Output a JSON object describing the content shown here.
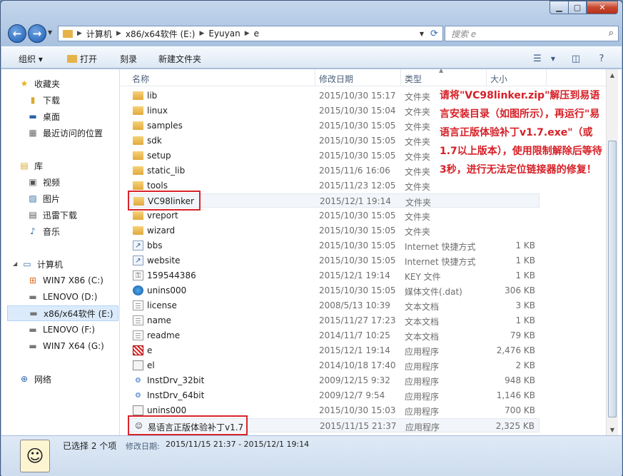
{
  "window": {
    "min_icon": "minimize-icon",
    "max_icon": "maximize-icon",
    "close_label": "✕"
  },
  "address": {
    "crumbs": [
      "计算机",
      "x86/x64软件 (E:)",
      "Eyuyan",
      "e"
    ],
    "search_placeholder": "搜索 e"
  },
  "toolbar": {
    "organize": "组织 ▾",
    "open": "打开",
    "burn": "刻录",
    "new_folder": "新建文件夹"
  },
  "nav": {
    "favorites": "收藏夹",
    "downloads": "下载",
    "desktop": "桌面",
    "recent": "最近访问的位置",
    "libraries": "库",
    "videos": "视频",
    "pictures": "图片",
    "thunder": "迅雷下载",
    "music": "音乐",
    "computer": "计算机",
    "drive_c": "WIN7 X86 (C:)",
    "drive_d": "LENOVO (D:)",
    "drive_e": "x86/x64软件 (E:)",
    "drive_f": "LENOVO (F:)",
    "drive_g": "WIN7 X64 (G:)",
    "network": "网络"
  },
  "columns": {
    "name": "名称",
    "date": "修改日期",
    "type": "类型",
    "size": "大小"
  },
  "files": [
    {
      "name": "lib",
      "date": "2015/10/30 15:17",
      "type": "文件夹",
      "size": "",
      "icon": "folder"
    },
    {
      "name": "linux",
      "date": "2015/10/30 15:04",
      "type": "文件夹",
      "size": "",
      "icon": "folder"
    },
    {
      "name": "samples",
      "date": "2015/10/30 15:05",
      "type": "文件夹",
      "size": "",
      "icon": "folder"
    },
    {
      "name": "sdk",
      "date": "2015/10/30 15:05",
      "type": "文件夹",
      "size": "",
      "icon": "folder"
    },
    {
      "name": "setup",
      "date": "2015/10/30 15:05",
      "type": "文件夹",
      "size": "",
      "icon": "folder"
    },
    {
      "name": "static_lib",
      "date": "2015/11/6 16:06",
      "type": "文件夹",
      "size": "",
      "icon": "folder"
    },
    {
      "name": "tools",
      "date": "2015/11/23 12:05",
      "type": "文件夹",
      "size": "",
      "icon": "folder"
    },
    {
      "name": "VC98linker",
      "date": "2015/12/1 19:14",
      "type": "文件夹",
      "size": "",
      "icon": "folder"
    },
    {
      "name": "vreport",
      "date": "2015/10/30 15:05",
      "type": "文件夹",
      "size": "",
      "icon": "folder"
    },
    {
      "name": "wizard",
      "date": "2015/10/30 15:05",
      "type": "文件夹",
      "size": "",
      "icon": "folder"
    },
    {
      "name": "bbs",
      "date": "2015/10/30 15:05",
      "type": "Internet 快捷方式",
      "size": "1 KB",
      "icon": "shortcut"
    },
    {
      "name": "website",
      "date": "2015/10/30 15:05",
      "type": "Internet 快捷方式",
      "size": "1 KB",
      "icon": "shortcut"
    },
    {
      "name": "159544386",
      "date": "2015/12/1 19:14",
      "type": "KEY 文件",
      "size": "1 KB",
      "icon": "key"
    },
    {
      "name": "unins000",
      "date": "2015/10/30 15:05",
      "type": "媒体文件(.dat)",
      "size": "306 KB",
      "icon": "media"
    },
    {
      "name": "license",
      "date": "2008/5/13 10:39",
      "type": "文本文档",
      "size": "3 KB",
      "icon": "doc"
    },
    {
      "name": "name",
      "date": "2015/11/27 17:23",
      "type": "文本文档",
      "size": "1 KB",
      "icon": "doc"
    },
    {
      "name": "readme",
      "date": "2014/11/7 10:25",
      "type": "文本文档",
      "size": "79 KB",
      "icon": "doc"
    },
    {
      "name": "e",
      "date": "2015/12/1 19:14",
      "type": "应用程序",
      "size": "2,476 KB",
      "icon": "e-app"
    },
    {
      "name": "el",
      "date": "2014/10/18 17:40",
      "type": "应用程序",
      "size": "2 KB",
      "icon": "app"
    },
    {
      "name": "InstDrv_32bit",
      "date": "2009/12/15 9:32",
      "type": "应用程序",
      "size": "948 KB",
      "icon": "gear"
    },
    {
      "name": "InstDrv_64bit",
      "date": "2009/12/7 9:54",
      "type": "应用程序",
      "size": "1,146 KB",
      "icon": "gear"
    },
    {
      "name": "unins000",
      "date": "2015/10/30 15:03",
      "type": "应用程序",
      "size": "700 KB",
      "icon": "app"
    },
    {
      "name": "易语言正版体验补丁v1.7",
      "date": "2015/11/15 21:37",
      "type": "应用程序",
      "size": "2,325 KB",
      "icon": "smile"
    }
  ],
  "annotation": "请将\"VC98linker.zip\"解压到易语言安装目录（如图所示），再运行\"易语言正版体验补丁v1.7.exe\"（或1.7以上版本），使用限制解除后等待3秒，进行无法定位链接器的修复！",
  "status": {
    "selected": "已选择 2 个项",
    "modified_label": "修改日期:",
    "modified_value": "2015/11/15 21:37 - 2015/12/1 19:14"
  }
}
